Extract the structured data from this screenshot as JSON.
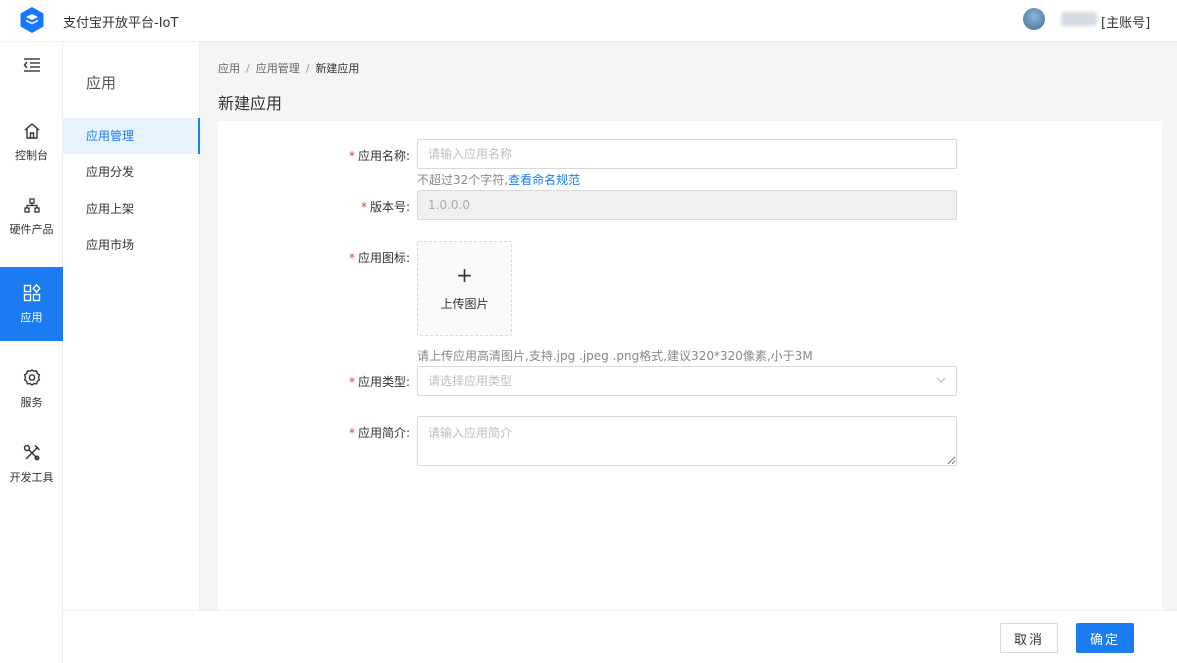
{
  "header": {
    "app_title": "支付宝开放平台-IoT",
    "account_tag": "[主账号]"
  },
  "rail": {
    "items": [
      {
        "label": "控制台",
        "icon": "home-icon"
      },
      {
        "label": "硬件产品",
        "icon": "hardware-icon"
      },
      {
        "label": "应用",
        "icon": "apps-icon",
        "active": true
      },
      {
        "label": "服务",
        "icon": "gear-icon"
      },
      {
        "label": "开发工具",
        "icon": "tools-icon"
      }
    ]
  },
  "subnav": {
    "title": "应用",
    "items": [
      {
        "label": "应用管理",
        "active": true
      },
      {
        "label": "应用分发"
      },
      {
        "label": "应用上架"
      },
      {
        "label": "应用市场"
      }
    ]
  },
  "breadcrumb": {
    "items": [
      "应用",
      "应用管理",
      "新建应用"
    ],
    "sep": "/"
  },
  "page": {
    "title": "新建应用"
  },
  "form": {
    "required_mark": "*",
    "name": {
      "label": "应用名称:",
      "placeholder": "请输入应用名称",
      "hint": "不超过32个字符,",
      "hint_link": "查看命名规范"
    },
    "version": {
      "label": "版本号:",
      "value": "1.0.0.0"
    },
    "icon": {
      "label": "应用图标:",
      "upload_plus": "+",
      "upload_text": "上传图片",
      "hint": "请上传应用高清图片,支持.jpg .jpeg .png格式,建议320*320像素,小于3M"
    },
    "type": {
      "label": "应用类型:",
      "placeholder": "请选择应用类型"
    },
    "intro": {
      "label": "应用简介:",
      "placeholder": "请输入应用简介"
    }
  },
  "footer": {
    "cancel_label": "取消",
    "ok_label": "确定"
  },
  "colors": {
    "accent": "#1a7cf0",
    "required": "#e2403a",
    "background": "#f5f5f5"
  }
}
